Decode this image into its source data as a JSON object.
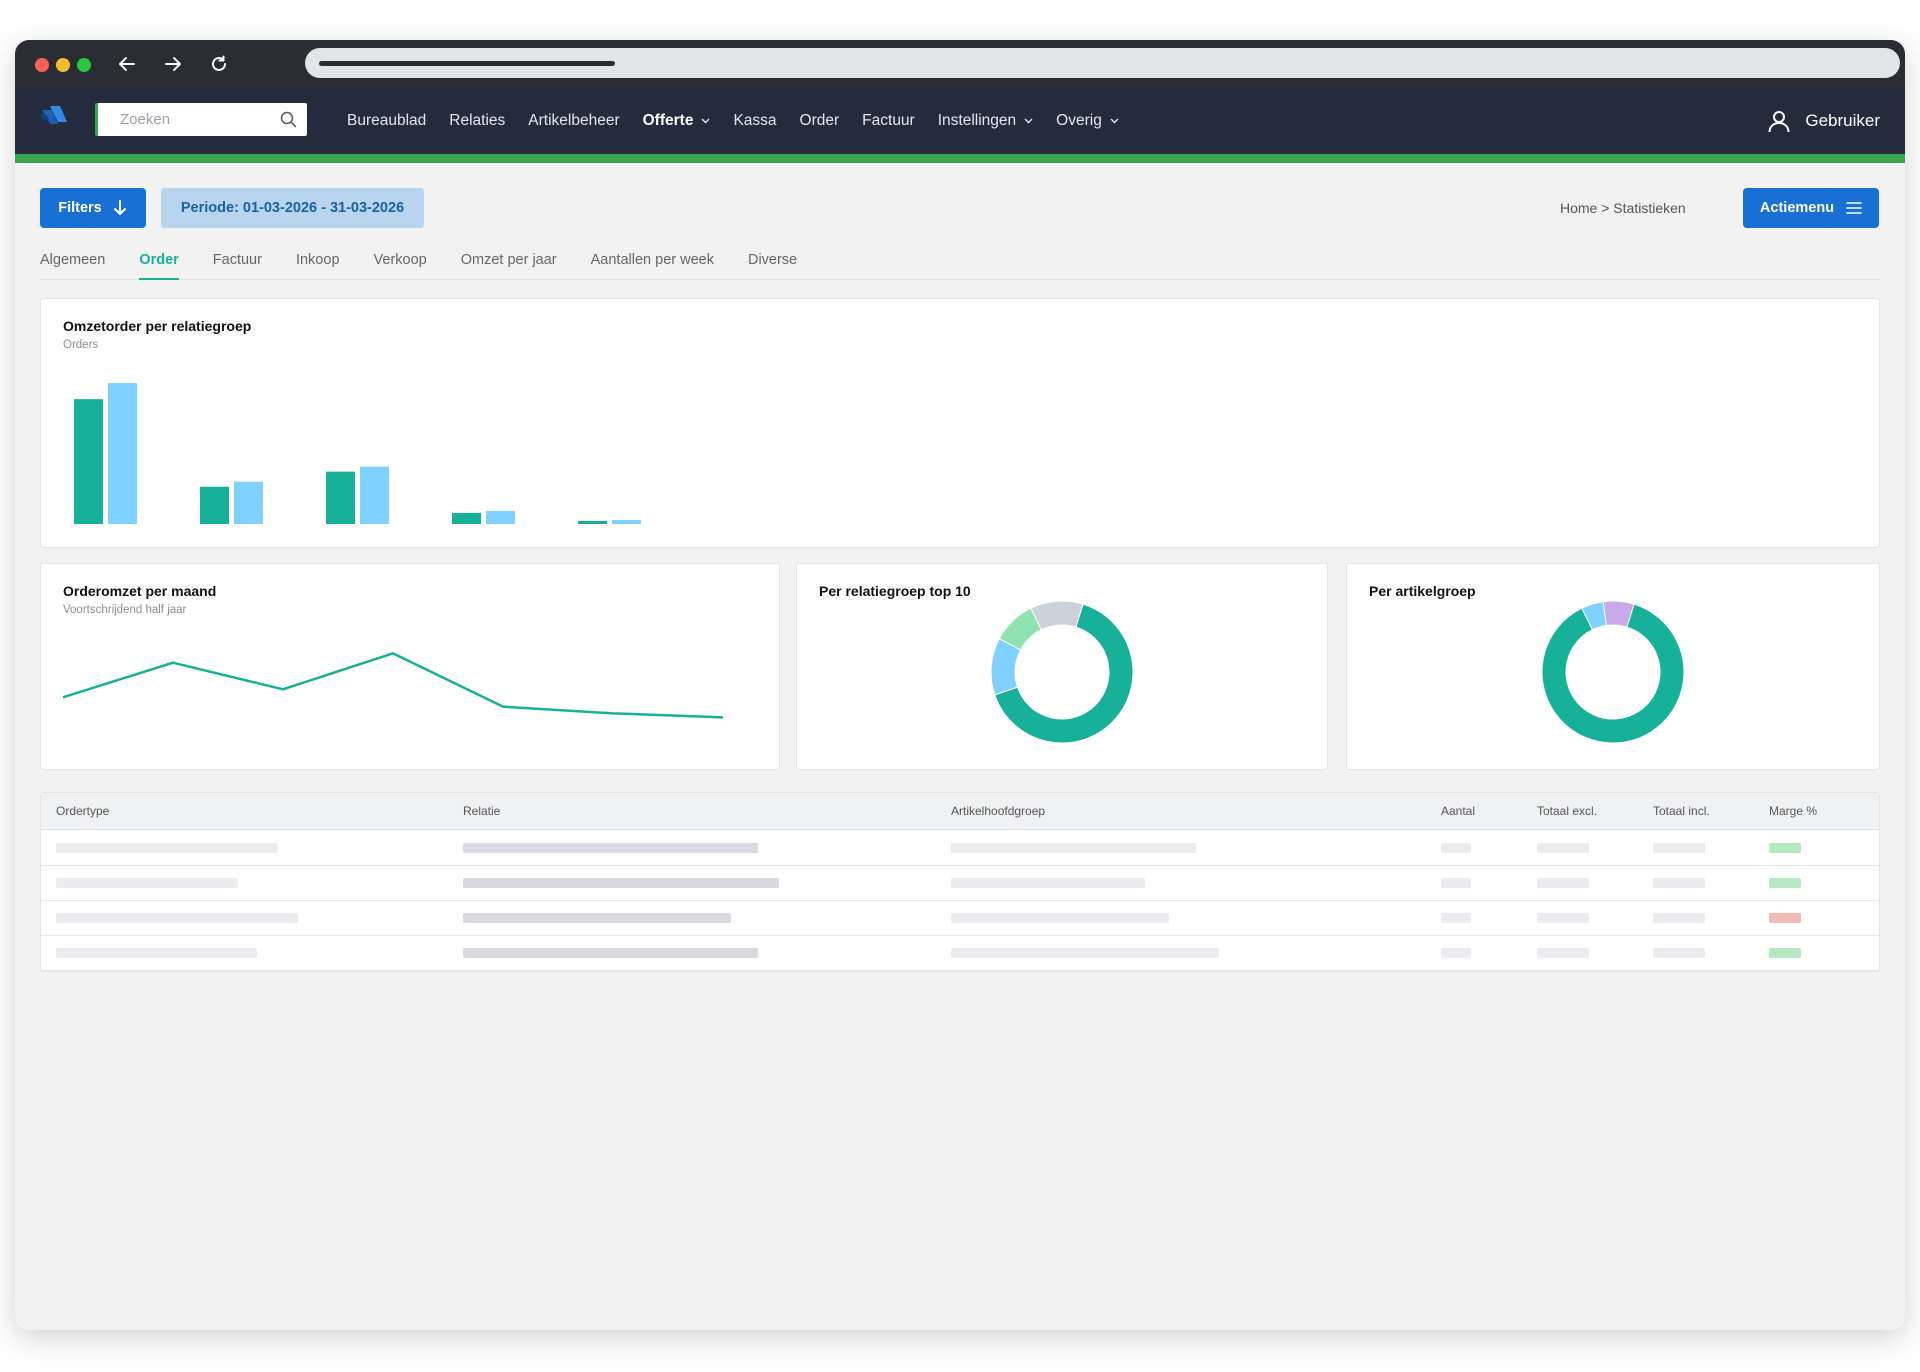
{
  "browser": {
    "back": "back-arrow-icon",
    "forward": "forward-arrow-icon",
    "reload": "reload-icon"
  },
  "header": {
    "search_placeholder": "Zoeken",
    "menu": [
      {
        "label": "Bureaublad"
      },
      {
        "label": "Relaties"
      },
      {
        "label": "Artikelbeheer"
      },
      {
        "label": "Offerte",
        "dropdown": true,
        "active": true
      },
      {
        "label": "Kassa"
      },
      {
        "label": "Order"
      },
      {
        "label": "Factuur"
      },
      {
        "label": "Instellingen",
        "dropdown": true
      },
      {
        "label": "Overig",
        "dropdown": true
      }
    ],
    "user_label": "Gebruiker"
  },
  "toolbar": {
    "filters_label": "Filters",
    "period_label": "Periode: 01-03-2026 - 31-03-2026",
    "breadcrumb": "Home > Statistieken",
    "actions_label": "Actiemenu"
  },
  "tabs": [
    "Algemeen",
    "Order",
    "Factuur",
    "Inkoop",
    "Verkoop",
    "Omzet per jaar",
    "Aantallen per week",
    "Diverse"
  ],
  "active_tab": "Order",
  "colors": {
    "accent": "#17b19a",
    "primary": "#1870d5",
    "light_blue": "#7fd2ff",
    "brand_green": "#3aa551",
    "navbar": "#242b3d"
  },
  "cards": {
    "bar": {
      "title": "Omzetorder per relatiegroep",
      "subtitle": "Orders"
    },
    "line": {
      "title": "Orderomzet per maand",
      "subtitle": "Voortschrijdend half jaar"
    },
    "donut1": {
      "title": "Per relatiegroep top 10"
    },
    "donut2": {
      "title": "Per artikelgroep"
    }
  },
  "chart_data": [
    {
      "type": "bar",
      "categories": [
        "",
        "",
        "",
        "",
        ""
      ],
      "series": [
        {
          "values": [
            124,
            37,
            52,
            11,
            3
          ]
        },
        {
          "values": [
            140,
            42,
            57,
            13,
            4
          ]
        }
      ],
      "ylim": [
        0,
        145
      ],
      "grid": false
    },
    {
      "type": "line",
      "x": [
        1,
        2,
        3,
        4,
        5,
        6,
        7
      ],
      "series": [
        {
          "values": [
            20,
            46,
            26,
            53,
            13,
            8,
            5
          ]
        }
      ],
      "ylim": [
        0,
        60
      ],
      "grid": false
    },
    {
      "type": "pie",
      "donut": true,
      "slices": [
        {
          "value": 65,
          "color": "#17b19a"
        },
        {
          "value": 13,
          "color": "#7fd2ff"
        },
        {
          "value": 10,
          "color": "#8ee3b0"
        },
        {
          "value": 12,
          "color": "#cdd1d9"
        }
      ]
    },
    {
      "type": "pie",
      "donut": true,
      "slices": [
        {
          "value": 88,
          "color": "#17b19a"
        },
        {
          "value": 5,
          "color": "#7fd2ff"
        },
        {
          "value": 7,
          "color": "#c7a9ec"
        }
      ]
    }
  ],
  "table": {
    "columns": [
      "Ordertype",
      "Relatie",
      "Artikelhoofdgroep",
      "Aantal",
      "Totaal excl.",
      "Totaal incl.",
      "Marge %"
    ],
    "rows": [
      {
        "marge_status": "positive"
      },
      {
        "marge_status": "positive"
      },
      {
        "marge_status": "negative"
      },
      {
        "marge_status": "positive"
      }
    ]
  }
}
